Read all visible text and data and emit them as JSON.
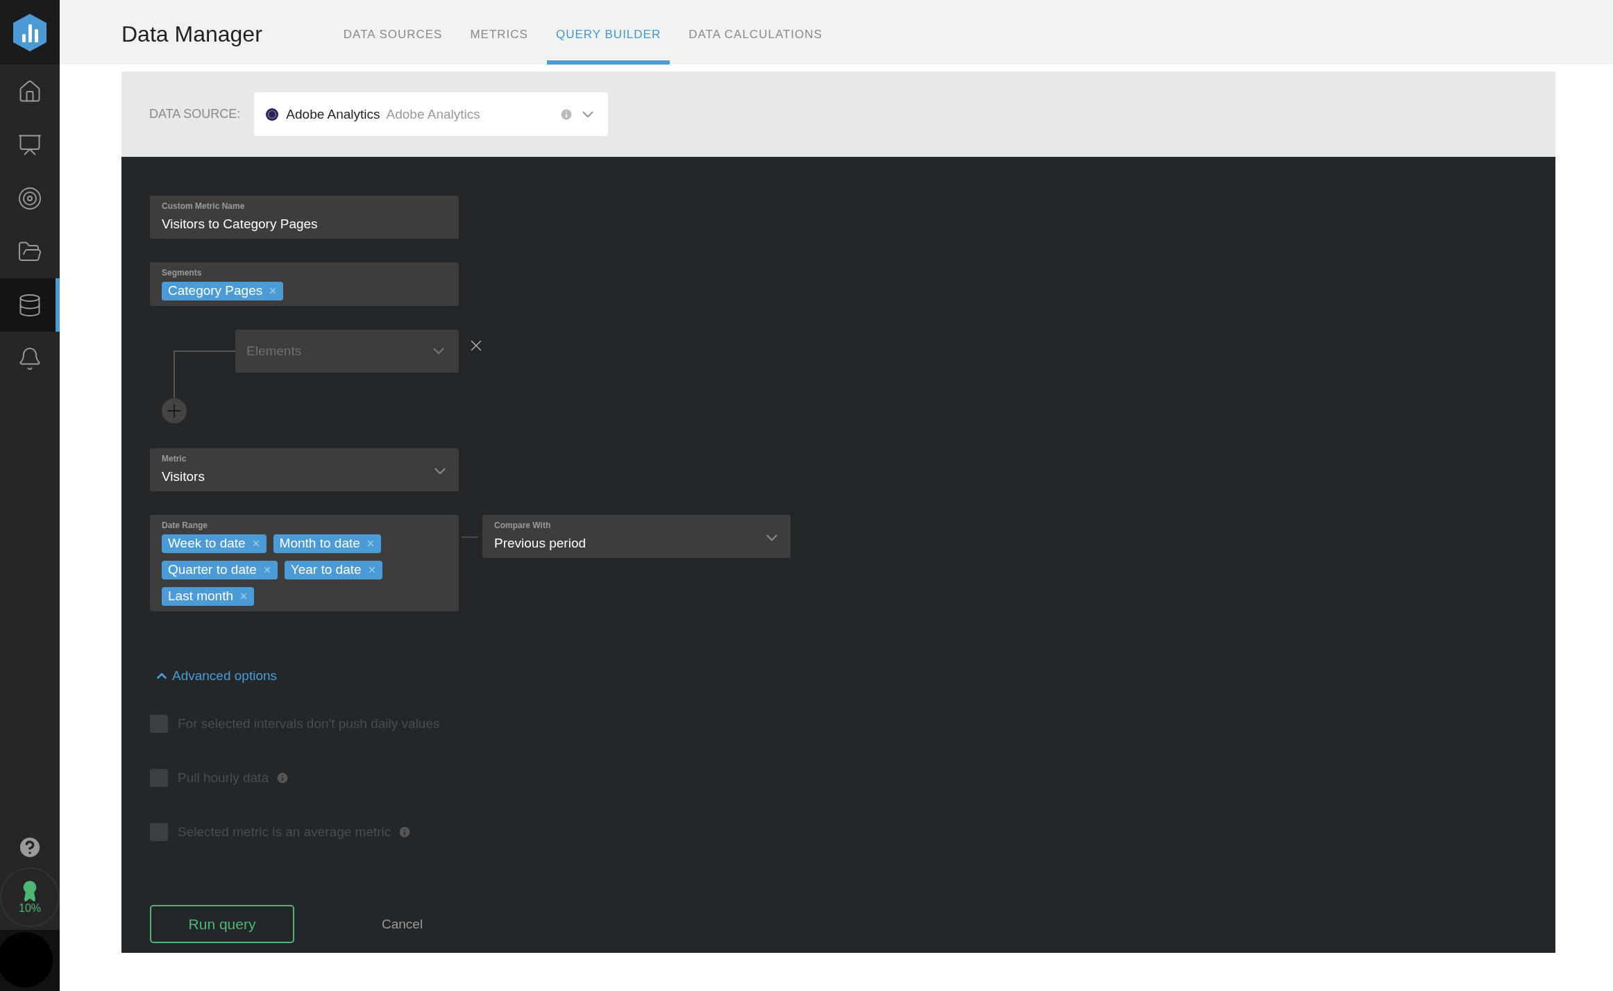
{
  "sidebar": {
    "items": [
      {
        "selected": false
      },
      {
        "selected": false
      },
      {
        "selected": false
      },
      {
        "selected": false
      },
      {
        "selected": true
      },
      {
        "selected": false
      }
    ],
    "progress": "10%"
  },
  "header": {
    "title": "Data Manager",
    "tabs": [
      {
        "label": "DATA SOURCES",
        "selected": false
      },
      {
        "label": "METRICS",
        "selected": false
      },
      {
        "label": "QUERY BUILDER",
        "selected": true
      },
      {
        "label": "DATA CALCULATIONS",
        "selected": false
      }
    ]
  },
  "data_source": {
    "label": "DATA SOURCE:",
    "value": "Adobe Analytics",
    "detail": "Adobe Analytics"
  },
  "form": {
    "custom_metric_name": {
      "label": "Custom Metric Name",
      "value": "Visitors to Category Pages"
    },
    "segments": {
      "label": "Segments",
      "tags": [
        "Category Pages"
      ]
    },
    "elements": {
      "placeholder": "Elements"
    },
    "metric": {
      "label": "Metric",
      "value": "Visitors"
    },
    "date_range": {
      "label": "Date Range",
      "tags": [
        "Week to date",
        "Month to date",
        "Quarter to date",
        "Year to date",
        "Last month"
      ]
    },
    "compare_with": {
      "label": "Compare With",
      "value": "Previous period"
    },
    "advanced": {
      "label": "Advanced options",
      "expanded": true,
      "options": [
        {
          "label": "For selected intervals don't push daily values",
          "checked": false,
          "disabled": true,
          "info": false
        },
        {
          "label": "Pull hourly data",
          "checked": false,
          "disabled": true,
          "info": true
        },
        {
          "label": "Selected metric is an average metric",
          "checked": false,
          "disabled": true,
          "info": true
        }
      ]
    },
    "buttons": {
      "run": "Run query",
      "cancel": "Cancel"
    }
  }
}
